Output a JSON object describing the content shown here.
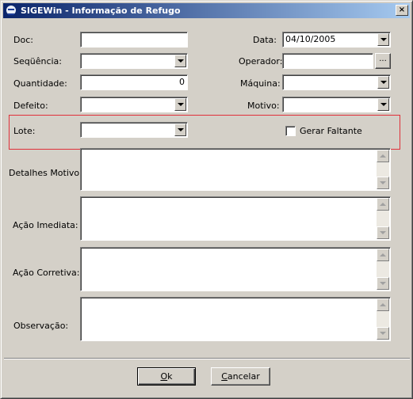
{
  "window": {
    "title": "SIGEWin - Informação de Refugo",
    "close_glyph": "×"
  },
  "form": {
    "doc": {
      "label": "Doc:",
      "value": ""
    },
    "data": {
      "label": "Data:",
      "value": "04/10/2005"
    },
    "sequencia": {
      "label": "Seqüência:",
      "value": ""
    },
    "operador": {
      "label": "Operador:",
      "value": "",
      "button": "..."
    },
    "quantidade": {
      "label": "Quantidade:",
      "value": "0"
    },
    "maquina": {
      "label": "Máquina:",
      "value": ""
    },
    "defeito": {
      "label": "Defeito:",
      "value": ""
    },
    "motivo": {
      "label": "Motivo:",
      "value": ""
    },
    "lote": {
      "label": "Lote:",
      "value": ""
    },
    "gerar_faltante": {
      "label": "Gerar Faltante",
      "checked": false
    },
    "detalhes_motivo": {
      "label": "Detalhes Motivo:",
      "value": ""
    },
    "acao_imediata": {
      "label": "Ação Imediata:",
      "value": ""
    },
    "acao_corretiva": {
      "label": "Ação Corretiva:",
      "value": ""
    },
    "observacao": {
      "label": "Observação:",
      "value": ""
    }
  },
  "buttons": {
    "ok": {
      "mnemonic": "O",
      "rest": "k"
    },
    "cancelar": {
      "mnemonic": "C",
      "rest": "ancelar"
    }
  },
  "colors": {
    "titlebar_start": "#0a246a",
    "titlebar_end": "#a6caf0",
    "face": "#d4d0c8",
    "highlight_box": "#e0303a"
  }
}
